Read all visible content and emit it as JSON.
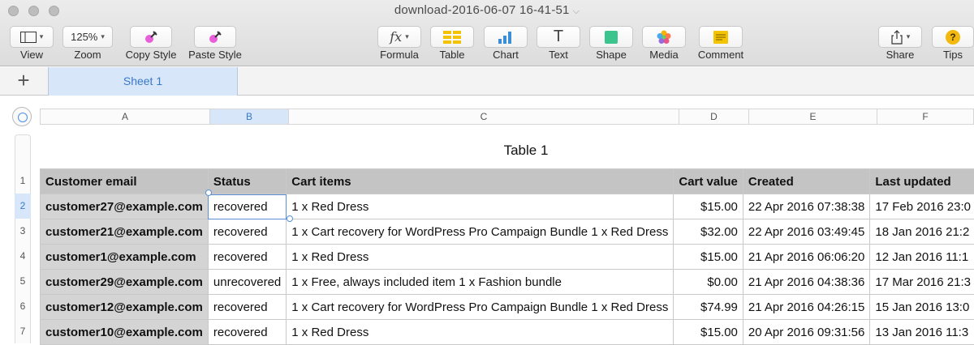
{
  "window": {
    "title": "download-2016-06-07 16-41-51"
  },
  "toolbar": {
    "view_label": "View",
    "zoom_value": "125%",
    "zoom_label": "Zoom",
    "copy_style_label": "Copy Style",
    "paste_style_label": "Paste Style",
    "formula_label": "Formula",
    "formula_glyph": "fx",
    "table_label": "Table",
    "chart_label": "Chart",
    "text_label": "Text",
    "text_glyph": "T",
    "shape_label": "Shape",
    "media_label": "Media",
    "comment_label": "Comment",
    "share_label": "Share",
    "tips_label": "Tips",
    "tips_glyph": "?",
    "colors": {
      "table": "#f3c300",
      "chart": "#3b8fd9",
      "shape": "#3cc48e",
      "comment": "#f4c400",
      "tips": "#f3b90e"
    }
  },
  "sheets": {
    "add_label": "+",
    "tabs": [
      {
        "label": "Sheet 1"
      }
    ]
  },
  "columns": [
    {
      "letter": "A"
    },
    {
      "letter": "B"
    },
    {
      "letter": "C"
    },
    {
      "letter": "D"
    },
    {
      "letter": "E"
    },
    {
      "letter": "F"
    }
  ],
  "table": {
    "title": "Table 1",
    "header": [
      "Customer email",
      "Status",
      "Cart items",
      "Cart value",
      "Created",
      "Last updated"
    ],
    "rows": [
      [
        "customer27@example.com",
        "recovered",
        "1 x Red Dress",
        "$15.00",
        "22 Apr 2016 07:38:38",
        "17 Feb 2016 23:0"
      ],
      [
        "customer21@example.com",
        "recovered",
        "1 x Cart recovery for WordPress Pro Campaign Bundle 1 x Red Dress",
        "$32.00",
        "22 Apr 2016 03:49:45",
        "18 Jan 2016 21:2"
      ],
      [
        "customer1@example.com",
        "recovered",
        "1 x Red Dress",
        "$15.00",
        "21 Apr 2016 06:06:20",
        "12 Jan 2016 11:1"
      ],
      [
        "customer29@example.com",
        "unrecovered",
        "1 x Free, always included item 1 x Fashion bundle",
        "$0.00",
        "21 Apr 2016 04:38:36",
        "17 Mar 2016 21:3"
      ],
      [
        "customer12@example.com",
        "recovered",
        "1 x Cart recovery for WordPress Pro Campaign Bundle 1 x Red Dress",
        "$74.99",
        "21 Apr 2016 04:26:15",
        "15 Jan 2016 13:0"
      ],
      [
        "customer10@example.com",
        "recovered",
        "1 x Red Dress",
        "$15.00",
        "20 Apr 2016 09:31:56",
        "13 Jan 2016 11:3"
      ]
    ],
    "row_numbers": [
      "1",
      "2",
      "3",
      "4",
      "5",
      "6",
      "7"
    ]
  }
}
